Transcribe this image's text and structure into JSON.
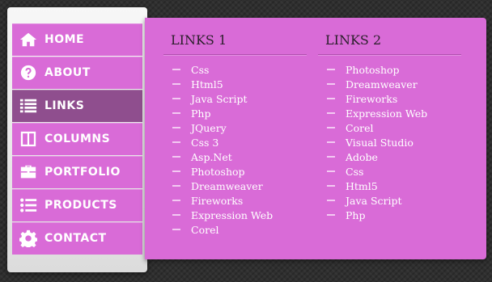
{
  "menu": [
    {
      "label": "HOME",
      "icon": "home-icon"
    },
    {
      "label": "ABOUT",
      "icon": "question-icon"
    },
    {
      "label": "LINKS",
      "icon": "list-icon"
    },
    {
      "label": "COLUMNS",
      "icon": "columns-icon"
    },
    {
      "label": "PORTFOLIO",
      "icon": "briefcase-icon"
    },
    {
      "label": "PRODUCTS",
      "icon": "bulleted-list-icon"
    },
    {
      "label": "CONTACT",
      "icon": "gear-icon"
    }
  ],
  "active_menu": "LINKS",
  "links1": {
    "heading": "LINKS 1",
    "items": [
      "Css",
      "Html5",
      "Java Script",
      "Php",
      "JQuery",
      "Css 3",
      "Asp.Net",
      "Photoshop",
      "Dreamweaver",
      "Fireworks",
      "Expression Web",
      "Corel"
    ]
  },
  "links2": {
    "heading": "LINKS 2",
    "items": [
      "Photoshop",
      "Dreamweaver",
      "Fireworks",
      "Expression Web",
      "Corel",
      "Visual Studio",
      "Adobe",
      "Css",
      "Html5",
      "Java Script",
      "Php"
    ]
  },
  "colors": {
    "accent": "#d96bd7",
    "active": "#8f4e8e",
    "background": "#2f2f2f"
  }
}
